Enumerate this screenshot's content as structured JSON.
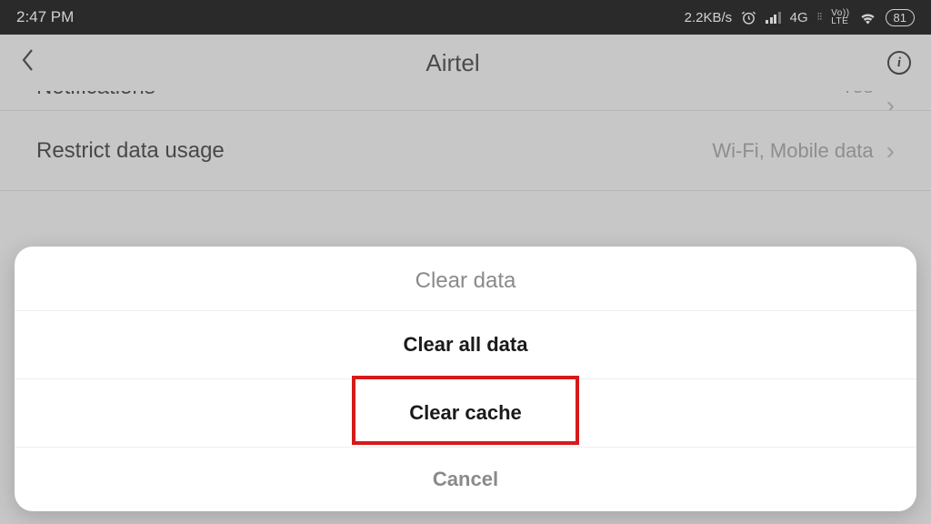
{
  "status": {
    "time": "2:47 PM",
    "net_speed": "2.2KB/s",
    "network_type": "4G",
    "volte_top": "Vo))",
    "volte_bot": "LTE",
    "battery": "81"
  },
  "header": {
    "title": "Airtel"
  },
  "rows": {
    "notifications": {
      "label": "Notifications",
      "value": "Yes"
    },
    "restrict": {
      "label": "Restrict data usage",
      "value": "Wi-Fi, Mobile data"
    }
  },
  "sheet": {
    "title": "Clear data",
    "clear_all": "Clear all data",
    "clear_cache": "Clear cache",
    "cancel": "Cancel"
  }
}
